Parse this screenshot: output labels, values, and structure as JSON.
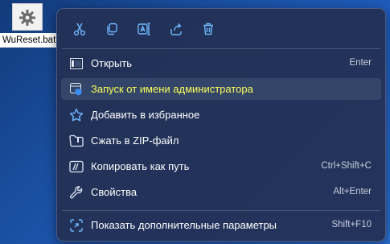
{
  "desktop": {
    "file_name": "WuReset.bat",
    "file_icon": "batch-gear-icon"
  },
  "menu": {
    "toolbar": [
      {
        "name": "cut",
        "icon": "scissors-icon"
      },
      {
        "name": "copy",
        "icon": "copy-icon"
      },
      {
        "name": "rename",
        "icon": "rename-icon"
      },
      {
        "name": "share",
        "icon": "share-icon"
      },
      {
        "name": "delete",
        "icon": "trash-icon"
      }
    ],
    "items": [
      {
        "label": "Открыть",
        "shortcut": "Enter",
        "icon": "open-icon"
      },
      {
        "label": "Запуск от имени администратора",
        "shortcut": "",
        "icon": "run-as-admin-icon"
      },
      {
        "label": "Добавить в избранное",
        "shortcut": "",
        "icon": "star-icon"
      },
      {
        "label": "Сжать в ZIP-файл",
        "shortcut": "",
        "icon": "zip-folder-icon"
      },
      {
        "label": "Копировать как путь",
        "shortcut": "Ctrl+Shift+C",
        "icon": "copy-path-icon"
      },
      {
        "label": "Свойства",
        "shortcut": "Alt+Enter",
        "icon": "wrench-icon"
      },
      {
        "label": "Показать дополнительные параметры",
        "shortcut": "Shift+F10",
        "icon": "more-options-icon"
      }
    ]
  },
  "colors": {
    "accent_icon": "#6fb8ff",
    "highlight_text": "#fbff57"
  }
}
